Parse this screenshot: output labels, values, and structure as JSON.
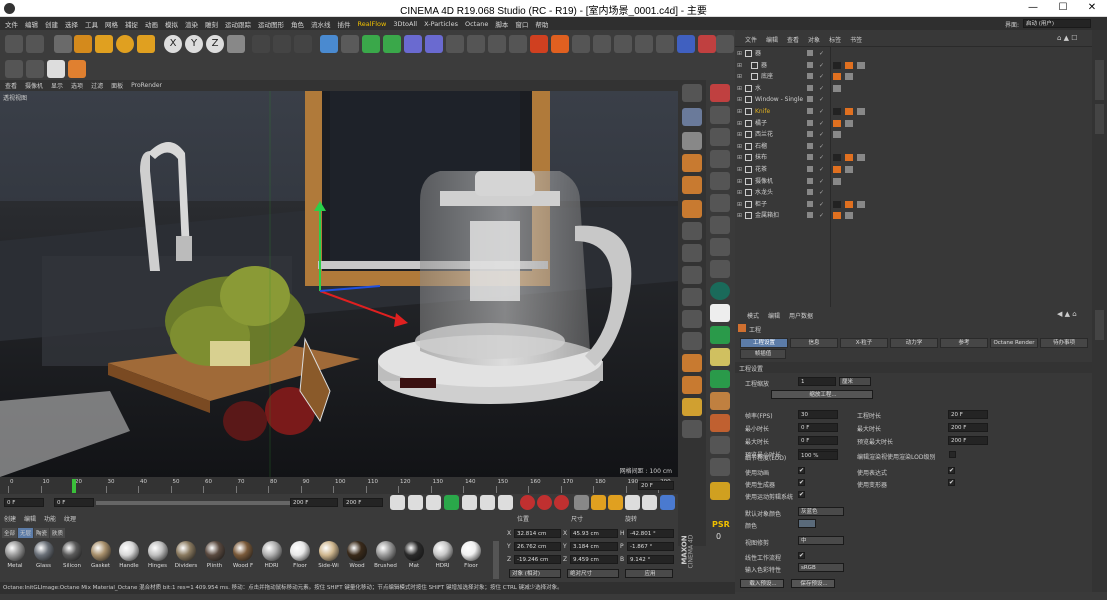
{
  "window": {
    "title": "CINEMA 4D R19.068 Studio (RC - R19) - [室内场景_0001.c4d] - 主要",
    "minimize": "—",
    "maximize": "☐",
    "close": "✕"
  },
  "menubar": {
    "items": [
      "文件",
      "编辑",
      "创建",
      "选择",
      "工具",
      "网格",
      "捕捉",
      "动画",
      "模拟",
      "渲染",
      "雕刻",
      "运动跟踪",
      "运动图形",
      "角色",
      "流水线",
      "插件",
      "RealFlow",
      "3DtoAll",
      "X-Particles",
      "Octane",
      "脚本",
      "窗口",
      "帮助"
    ],
    "highlight": "RealFlow"
  },
  "interface": {
    "label": "界面:",
    "value": "启动 (用户)"
  },
  "viewport": {
    "menu": [
      "查看",
      "摄像机",
      "显示",
      "选项",
      "过滤",
      "面板",
      "ProRender"
    ],
    "name": "透视视图",
    "grid_readout": "网格间距 : 100 cm"
  },
  "timeline": {
    "ticks": [
      "0",
      "10",
      "20",
      "30",
      "40",
      "50",
      "60",
      "70",
      "80",
      "90",
      "100",
      "110",
      "120",
      "130",
      "140",
      "150",
      "160",
      "170",
      "180",
      "190",
      "200"
    ],
    "current": "20",
    "end_label": "20 F"
  },
  "transport": {
    "start": "0 F",
    "current": "0 F",
    "end_a": "200 F",
    "end_b": "200 F"
  },
  "materials": {
    "menu": [
      "创建",
      "编辑",
      "功能",
      "纹理"
    ],
    "filters": [
      "全部",
      "无层",
      "陶瓷",
      "肤质"
    ],
    "items": [
      {
        "name": "Metal",
        "color": "#9a9a9a"
      },
      {
        "name": "Glass",
        "color": "#6a7078"
      },
      {
        "name": "Silicon",
        "color": "#5a5a5a"
      },
      {
        "name": "Gasket",
        "color": "#a8906c"
      },
      {
        "name": "Handle",
        "color": "#d8d8d8"
      },
      {
        "name": "Hinges",
        "color": "#c0c0c0"
      },
      {
        "name": "Dividers",
        "color": "#8a7a60"
      },
      {
        "name": "Plinth",
        "color": "#5a4a40"
      },
      {
        "name": "Wood F",
        "color": "#7a5a3a"
      },
      {
        "name": "HDRI",
        "color": "#b0b0b0"
      },
      {
        "name": "Floor",
        "color": "#e8e8e8"
      },
      {
        "name": "Side-Wi",
        "color": "#d0b890"
      },
      {
        "name": "Wood",
        "color": "#3a2a1a"
      },
      {
        "name": "Brushed",
        "color": "#9a9a9a"
      },
      {
        "name": "Mat",
        "color": "#2a2a2a"
      },
      {
        "name": "HDRI",
        "color": "#c8c8c8"
      },
      {
        "name": "Floor",
        "color": "#f0f0f0"
      }
    ]
  },
  "coords": {
    "headers": [
      "位置",
      "尺寸",
      "旋转"
    ],
    "rows": [
      {
        "axis": "X",
        "pos": "32.814 cm",
        "sizeAxis": "X",
        "size": "45.93 cm",
        "rotAxis": "H",
        "rot": "-42.801 °"
      },
      {
        "axis": "Y",
        "pos": "26.762 cm",
        "sizeAxis": "Y",
        "size": "3.184 cm",
        "rotAxis": "P",
        "rot": "-1.867 °"
      },
      {
        "axis": "Z",
        "pos": "-19.246 cm",
        "sizeAxis": "Z",
        "size": "9.459 cm",
        "rotAxis": "B",
        "rot": "9.142 °"
      }
    ],
    "mode": "对象 (相对)",
    "size_mode": "绝对尺寸",
    "apply": "应用"
  },
  "status": "Octane:InitGLImage:Octane Mix Material_Octane 混合材质  bit:1 res=1 409.954 ms.    移动：点击并拖动鼠标移动元素。按住 SHIFT 键量化移动；节点编辑模式时按住 SHIFT 键增加选择对象；按住 CTRL 键减少选择对象。",
  "objects": {
    "menu": [
      "文件",
      "编辑",
      "查看",
      "对象",
      "标签",
      "书签"
    ],
    "rows": [
      {
        "name": "器",
        "indent": 0,
        "color": "#cfcfcf"
      },
      {
        "name": "器",
        "indent": 1,
        "color": "#cfcfcf"
      },
      {
        "name": "底座",
        "indent": 1,
        "color": "#cfcfcf"
      },
      {
        "name": "水",
        "indent": 0,
        "color": "#cfcfcf"
      },
      {
        "name": "Window - Single",
        "indent": 0,
        "color": "#cfcfcf"
      },
      {
        "name": "Knife",
        "indent": 0,
        "color": "#e0b020"
      },
      {
        "name": "橘子",
        "indent": 0,
        "color": "#cfcfcf"
      },
      {
        "name": "西兰花",
        "indent": 0,
        "color": "#cfcfcf"
      },
      {
        "name": "石榴",
        "indent": 0,
        "color": "#cfcfcf"
      },
      {
        "name": "抹布",
        "indent": 0,
        "color": "#cfcfcf"
      },
      {
        "name": "花茶",
        "indent": 0,
        "color": "#cfcfcf"
      },
      {
        "name": "摄像机",
        "indent": 0,
        "color": "#cfcfcf"
      },
      {
        "name": "水龙头",
        "indent": 0,
        "color": "#cfcfcf"
      },
      {
        "name": "柜子",
        "indent": 0,
        "color": "#cfcfcf"
      },
      {
        "name": "金属箱扣",
        "indent": 0,
        "color": "#cfcfcf"
      }
    ]
  },
  "attributes": {
    "menu": [
      "模式",
      "编辑",
      "用户数据"
    ],
    "heading": "工程",
    "tabs": [
      "工程设置",
      "信息",
      "X-粒子",
      "动力学",
      "参考",
      "Octane Render",
      "待办事项"
    ],
    "tab2": "帧插值",
    "section": "工程设置",
    "scale_label": "工程缩放",
    "scale_value": "1",
    "scale_unit": "厘米",
    "scale_btn": "缩放工程...",
    "left": [
      {
        "label": "帧率(FPS)",
        "value": "30"
      },
      {
        "label": "最小时长",
        "value": "0 F"
      },
      {
        "label": "最大时长",
        "value": "0 F"
      },
      {
        "label": "预览最小时长",
        "value": "0 F"
      }
    ],
    "right": [
      {
        "label": "工程时长",
        "value": "20 F"
      },
      {
        "label": "最大时长",
        "value": "200 F"
      },
      {
        "label": "预览最大时长",
        "value": "200 F"
      }
    ],
    "lod_label": "细节程度(LOD)",
    "lod_value": "100 %",
    "lod_right": "编辑渲染视使用渲染LOD级别",
    "checks_left": [
      {
        "label": "使用动画",
        "mark": "✔"
      },
      {
        "label": "使用生成器",
        "mark": "✔"
      },
      {
        "label": "使用运动剪辑系统",
        "mark": "✔"
      }
    ],
    "checks_right": [
      {
        "label": "使用表达式",
        "mark": "✔"
      },
      {
        "label": "使用变形器",
        "mark": "✔"
      }
    ],
    "default_color_label": "默认对象颜色",
    "default_color_value": "灰蓝色",
    "color_label": "颜色",
    "view_label": "视图修剪",
    "view_value": "中",
    "linear_label": "线性工作流程",
    "linear_mark": "✔",
    "input_label": "输入色彩特性",
    "input_value": "sRGB",
    "btn_load": "载入预设...",
    "btn_save": "保存预设..."
  },
  "brand": {
    "line1": "MAXON",
    "line2": "CINEMA 4D"
  },
  "psr": {
    "label": "PSR",
    "value": "0"
  }
}
